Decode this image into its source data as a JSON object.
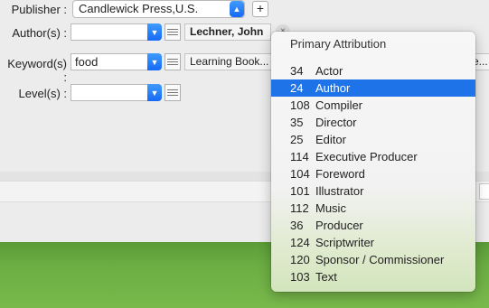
{
  "form": {
    "publisher": {
      "label": "Publisher :",
      "value": "Candlewick Press,U.S.",
      "add_label": "+"
    },
    "authors": {
      "label": "Author(s) :",
      "value": "",
      "tag": "Lechner, John",
      "remove_label": "×"
    },
    "keywords": {
      "label": "Keyword(s) :",
      "value": "food",
      "tag": "Learning Book...",
      "tag2": "e..."
    },
    "levels": {
      "label": "Level(s) :",
      "value": ""
    }
  },
  "menu": {
    "header": "Primary Attribution",
    "items": [
      {
        "num": "34",
        "name": "Actor"
      },
      {
        "num": "24",
        "name": "Author",
        "selected": true
      },
      {
        "num": "108",
        "name": "Compiler"
      },
      {
        "num": "35",
        "name": "Director"
      },
      {
        "num": "25",
        "name": "Editor"
      },
      {
        "num": "114",
        "name": "Executive Producer"
      },
      {
        "num": "104",
        "name": "Foreword"
      },
      {
        "num": "101",
        "name": "Illustrator"
      },
      {
        "num": "112",
        "name": "Music"
      },
      {
        "num": "36",
        "name": "Producer"
      },
      {
        "num": "124",
        "name": "Scriptwriter"
      },
      {
        "num": "120",
        "name": "Sponsor / Commissioner"
      },
      {
        "num": "103",
        "name": "Text"
      }
    ]
  },
  "icons": {
    "stepper": "up-down-chevron-icon",
    "combo": "chevron-down-icon",
    "list": "list-icon",
    "remove": "close-icon"
  },
  "colors": {
    "accent": "#1e73e8",
    "desktop": "#6cae43"
  }
}
